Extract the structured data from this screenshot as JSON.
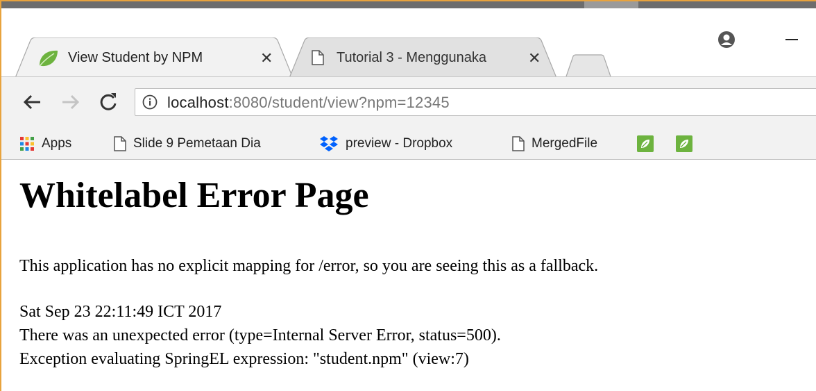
{
  "browser": {
    "tabs": [
      {
        "title": "View Student by NPM",
        "close": "✕",
        "active": true
      },
      {
        "title": "Tutorial 3 - Menggunaka",
        "close": "✕",
        "active": false
      }
    ],
    "address": {
      "host": "localhost",
      "path": ":8080/student/view?npm=12345"
    },
    "bookmarks": [
      {
        "label": "Apps",
        "icon": "apps-grid-icon"
      },
      {
        "label": "Slide 9 Pemetaan Dia",
        "icon": "page-icon"
      },
      {
        "label": "preview - Dropbox",
        "icon": "dropbox-icon"
      },
      {
        "label": "MergedFile",
        "icon": "page-icon"
      },
      {
        "label": "",
        "icon": "leaf-icon"
      },
      {
        "label": "",
        "icon": "leaf-icon"
      }
    ],
    "colors": {
      "accent_border": "#e8a33d",
      "spring_green": "#6db33f"
    }
  },
  "page": {
    "heading": "Whitelabel Error Page",
    "message": "This application has no explicit mapping for /error, so you are seeing this as a fallback.",
    "timestamp": "Sat Sep 23 22:11:49 ICT 2017",
    "error_line": "There was an unexpected error (type=Internal Server Error, status=500).",
    "exception": "Exception evaluating SpringEL expression: \"student.npm\" (view:7)"
  }
}
